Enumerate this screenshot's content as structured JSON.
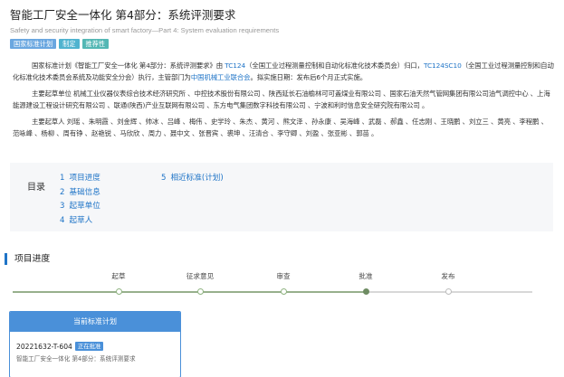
{
  "header": {
    "title": "智能工厂安全一体化 第4部分：系统评测要求",
    "subtitle": "Safety and security integration of smart factory—Part 4: System evaluation requirements",
    "badges": [
      "国家标准计划",
      "制定",
      "推荐性"
    ]
  },
  "description": {
    "p1": {
      "a": "国家标准计划《智能工厂安全一体化 第4部分：系统评测要求》由 ",
      "tc1": "TC124",
      "b": "（全国工业过程测量控制和自动化标准化技术委员会）归口，",
      "tc2": "TC124SC10",
      "c": "（全国工业过程测量控制和自动化标准化技术委员会系统及功能安全分会）执行，主管部门为",
      "dept": "中国机械工业联合会",
      "d": "。拟实施日期：发布后6个月正式实施。"
    },
    "p2": "主要起草单位 机械工业仪器仪表综合技术经济研究所 、中控技术股份有限公司 、陕西延长石油榆林可可盖煤业有限公司 、国家石油天然气管网集团有限公司油气调控中心 、上海能源建设工程设计研究有限公司 、联通(陕西)产业互联网有限公司 、东方电气集团数字科技有限公司 、宁波和利时信息安全研究院有限公司 。",
    "p3": "主要起草人 刘瑶 、朱明霞 、刘金辉 、帅冰 、吕峰 、梅伟 、史学玲 、朱杰 、黄河 、熊文泽 、孙永康 、吴海峰 、武磊 、郝鑫 、任志刚 、王晓鹏 、刘立三 、黄亮 、李程鹏 、范咏峰 、杨柳 、周有铮 、赵艳锐 、马欣欣 、周力 、聂中文 、张晋宾 、裘坤 、汪清合 、李守卿 、刘盈 、张亚彬 、郭苗 。"
  },
  "toc": {
    "title": "目录",
    "items": [
      {
        "num": "1",
        "label": "项目进度"
      },
      {
        "num": "2",
        "label": "基础信息"
      },
      {
        "num": "3",
        "label": "起草单位"
      },
      {
        "num": "4",
        "label": "起草人"
      },
      {
        "num": "5",
        "label": "相近标准(计划)"
      }
    ]
  },
  "progress": {
    "title": "项目进度",
    "steps": [
      {
        "label": "起草",
        "state": "done"
      },
      {
        "label": "征求意见",
        "state": "done"
      },
      {
        "label": "审查",
        "state": "done"
      },
      {
        "label": "批准",
        "state": "current"
      },
      {
        "label": "发布",
        "state": "pending"
      }
    ]
  },
  "plan_card": {
    "header": "当前标准计划",
    "code": "20221632-T-604",
    "status": "正在批准",
    "name": "智能工厂安全一体化 第4部分：系统评测要求"
  },
  "colors": {
    "link": "#1f74c7",
    "card_blue": "#4a90d9",
    "badge_plan": "#6aa7e0",
    "badge_develop": "#4fb3cf",
    "badge_recommended": "#53b7b4",
    "step_done": "#8fb381",
    "step_current": "#6f8c63"
  }
}
